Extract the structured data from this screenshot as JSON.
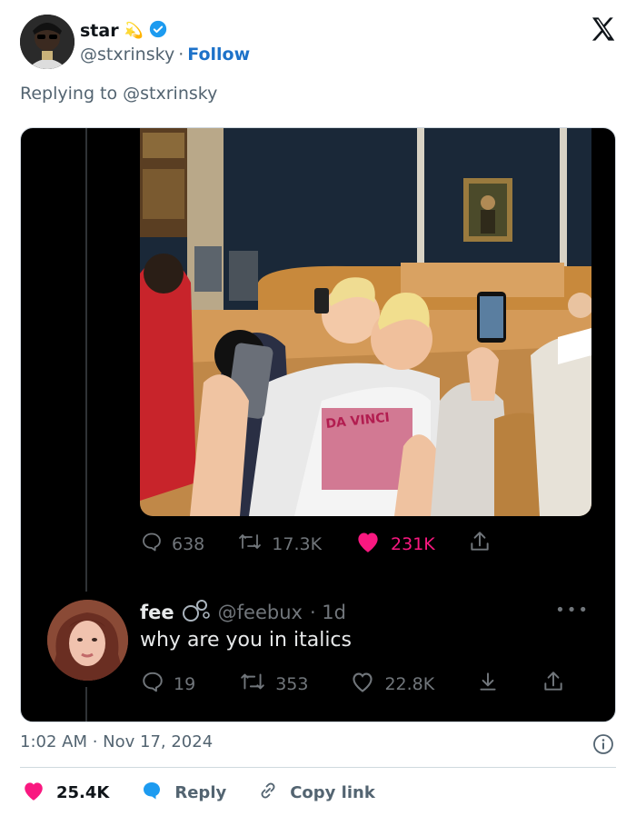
{
  "tweet": {
    "author": {
      "display_name": "star",
      "handle": "@stxrinsky",
      "emoji": "💫",
      "verified": true
    },
    "follow_label": "Follow",
    "separator": "·",
    "replying_to": "Replying to @stxrinsky",
    "timestamp": "1:02 AM · Nov 17, 2024"
  },
  "embedded": {
    "original": {
      "replies": "638",
      "retweets": "17.3K",
      "likes": "231K",
      "shirt_text": "DA VINCI"
    },
    "reply": {
      "display_name": "fee",
      "handle": "@feebux",
      "age": "· 1d",
      "text": "why are you in italics",
      "replies": "19",
      "retweets": "353",
      "likes": "22.8K",
      "more": "•••"
    }
  },
  "footer": {
    "likes": "25.4K",
    "reply_label": "Reply",
    "copy_link_label": "Copy link"
  },
  "colors": {
    "like_pink": "#f91880",
    "link_blue": "#1d72c9",
    "verified_blue": "#1d9bf0",
    "muted": "#536471"
  },
  "icons": [
    "x-logo-icon",
    "verified-badge-icon",
    "reply-icon",
    "retweet-icon",
    "heart-icon",
    "share-icon",
    "bookmark-icon",
    "info-icon",
    "link-icon"
  ]
}
